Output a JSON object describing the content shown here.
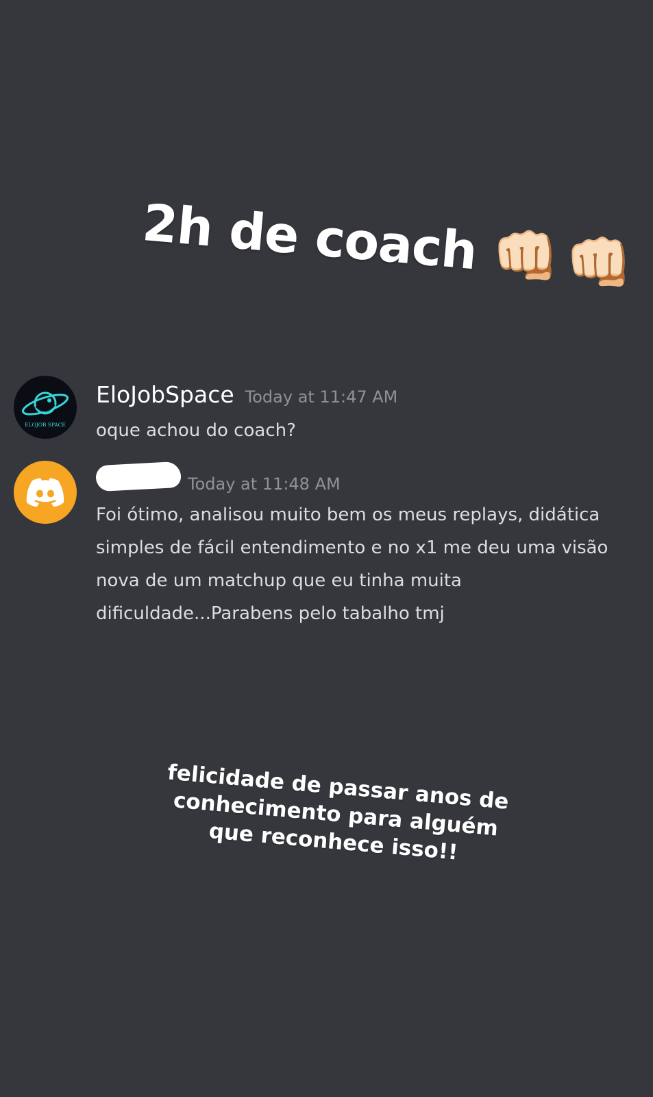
{
  "story": {
    "headline": "2h de coach",
    "headline_emoji": "👊🏻",
    "caption": "felicidade de passar anos de conhecimento para alguém que reconhece isso!!"
  },
  "messages": [
    {
      "author": "EloJobSpace",
      "timestamp": "Today at 11:47 AM",
      "content": "oque achou do coach?",
      "avatar": {
        "icon": "elojob-space-planet-logo",
        "logo_text": "ELOJOB SPACE",
        "background": "#0b0d14",
        "accent": "#38d6d8"
      }
    },
    {
      "author_redacted": true,
      "timestamp": "Today at 11:48 AM",
      "content": "Foi ótimo, analisou muito bem os meus replays, didática simples de fácil entendimento e no x1 me deu uma visão nova de um matchup que eu tinha muita dificuldade...Parabens pelo tabalho tmj",
      "avatar": {
        "icon": "discord-logo-icon",
        "background": "#f6a623"
      }
    }
  ],
  "colors": {
    "background": "#35373d",
    "username": "#ffffff",
    "timestamp": "#8e9297",
    "message_text": "#dcddde"
  }
}
